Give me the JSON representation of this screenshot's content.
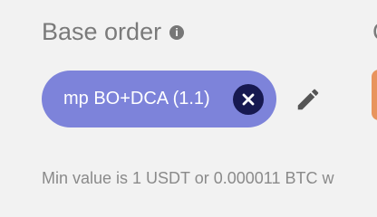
{
  "base_order": {
    "title": "Base order",
    "info_icon": "info-icon",
    "info_glyph": "i",
    "selected_chip": {
      "label": "mp BO+DCA (1.1)",
      "remove_icon": "close-icon",
      "color": "#7d83da",
      "remove_color": "#171950"
    },
    "edit_icon": "pencil-icon",
    "hint": "Min value is 1 USDT or 0.000011 BTC w"
  },
  "next_section": {
    "title_fragment": "C",
    "accent_color": "#e8945e"
  }
}
